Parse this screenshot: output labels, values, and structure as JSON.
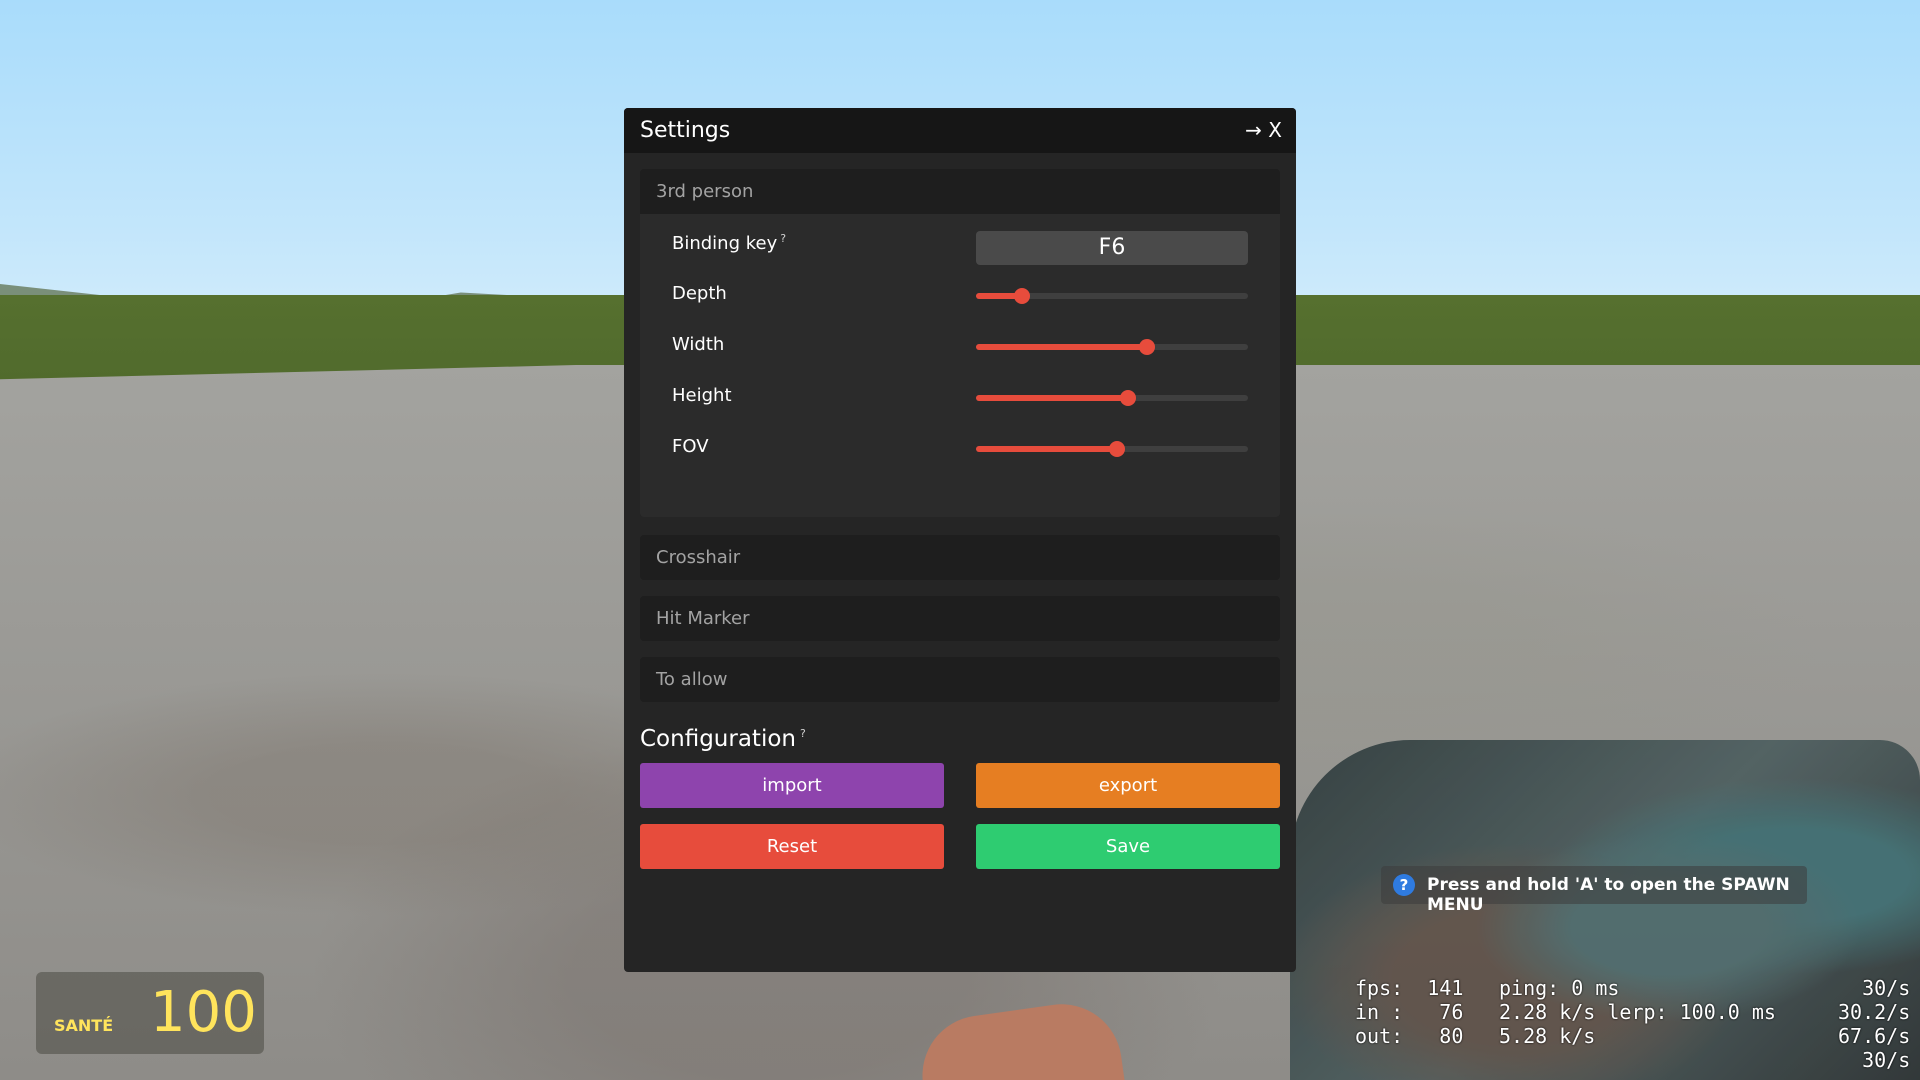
{
  "window": {
    "title": "Settings",
    "close_label": "→ X"
  },
  "sections": {
    "third_person": {
      "header": "3rd person",
      "binding_key_label": "Binding key",
      "help_marker": "?",
      "binding_key_value": "F6",
      "sliders": [
        {
          "label": "Depth",
          "level": 0.17
        },
        {
          "label": "Width",
          "level": 0.63
        },
        {
          "label": "Height",
          "level": 0.56
        },
        {
          "label": "FOV",
          "level": 0.52
        }
      ]
    },
    "crosshair": {
      "header": "Crosshair"
    },
    "hit_marker": {
      "header": "Hit Marker"
    },
    "to_allow": {
      "header": "To allow"
    }
  },
  "configuration": {
    "title": "Configuration",
    "help_marker": "?",
    "import_label": "import",
    "export_label": "export",
    "reset_label": "Reset",
    "save_label": "Save"
  },
  "colors": {
    "accent_slider": "#e74c3c",
    "import": "#8e44ad",
    "export": "#e67e22",
    "reset": "#e74c3c",
    "save": "#2ecc71",
    "hud_yellow": "#ffe45c"
  },
  "hud": {
    "health_label": "SANTÉ",
    "health_value": "100",
    "hint_icon": "?",
    "hint_text": "Press and hold 'A' to open the SPAWN MENU",
    "netgraph": {
      "col1": "fps:  141\nin :   76\nout:   80",
      "col2": "ping: 0 ms\n2.28 k/s lerp: 100.0 ms\n5.28 k/s",
      "col3": "30/s\n30.2/s\n67.6/s\n30/s"
    }
  }
}
